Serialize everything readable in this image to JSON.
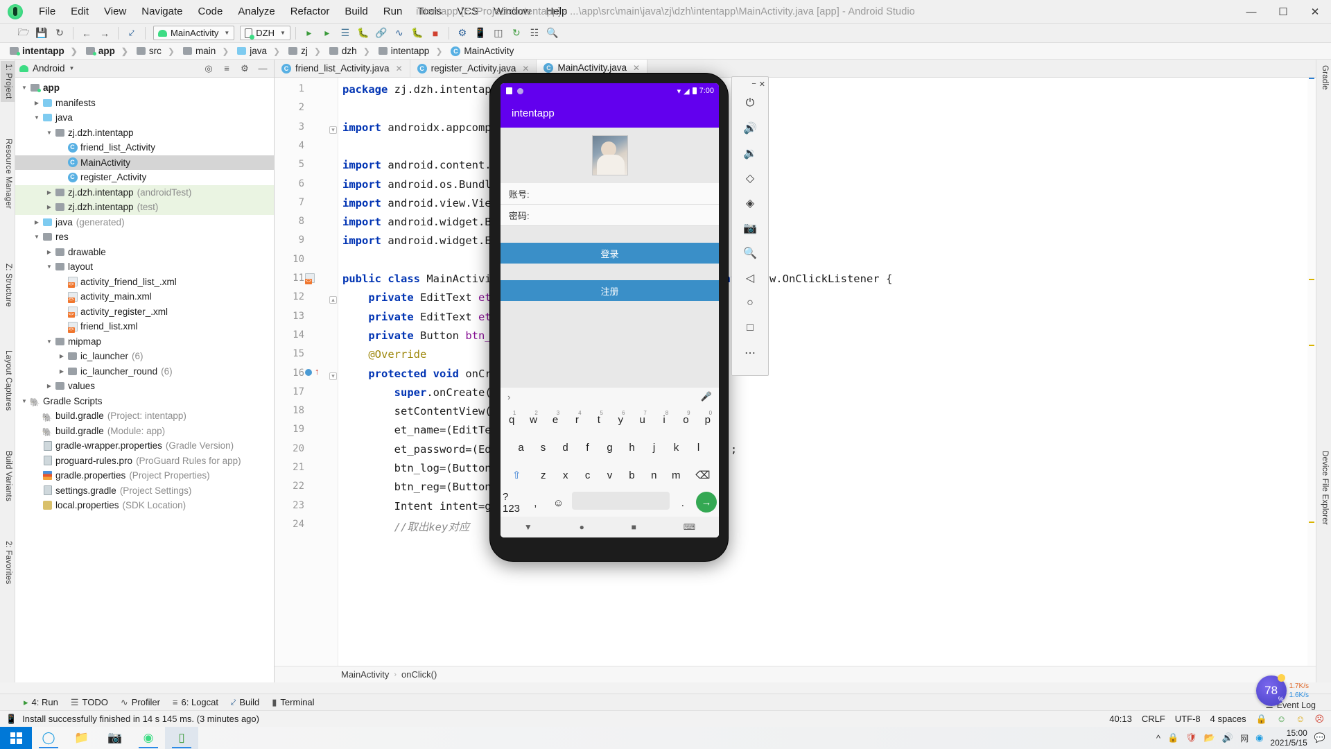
{
  "window": {
    "title": "intentapp [E:\\Projects\\intentapp] - ...\\app\\src\\main\\java\\zj\\dzh\\intentapp\\MainActivity.java [app] - Android Studio",
    "minimize": "—",
    "maximize": "☐",
    "close": "✕"
  },
  "menubar": [
    "File",
    "Edit",
    "View",
    "Navigate",
    "Code",
    "Analyze",
    "Refactor",
    "Build",
    "Run",
    "Tools",
    "VCS",
    "Window",
    "Help"
  ],
  "toolbar": {
    "run_config": "MainActivity",
    "device": "DZH",
    "icons": [
      "open-folder-icon",
      "save-icon",
      "sync-icon",
      "back-arrow-icon",
      "forward-arrow-icon",
      "undo-icon"
    ],
    "right_icons": [
      "run-icon",
      "run-coverage-icon",
      "apply-changes-icon",
      "debug-icon",
      "attach-debugger-icon",
      "profiler-icon",
      "debug-app-icon",
      "stop-icon",
      "sdk-manager-icon",
      "avd-manager-icon",
      "search-icon"
    ]
  },
  "breadcrumb": [
    {
      "label": "intentapp",
      "icon": "project-folder-icon",
      "bold": true
    },
    {
      "label": "app",
      "icon": "module-folder-icon",
      "bold": true
    },
    {
      "label": "src",
      "icon": "folder-icon",
      "bold": false
    },
    {
      "label": "main",
      "icon": "folder-icon",
      "bold": false
    },
    {
      "label": "java",
      "icon": "source-folder-icon",
      "bold": false
    },
    {
      "label": "zj",
      "icon": "package-folder-icon",
      "bold": false
    },
    {
      "label": "dzh",
      "icon": "package-folder-icon",
      "bold": false
    },
    {
      "label": "intentapp",
      "icon": "package-folder-icon",
      "bold": false
    },
    {
      "label": "MainActivity",
      "icon": "java-class-icon",
      "bold": false
    }
  ],
  "left_tool_tabs": [
    "1: Project",
    "Resource Manager",
    "Z: Structure",
    "Layout Captures",
    "Build Variants",
    "2: Favorites"
  ],
  "right_tool_tabs": [
    "Gradle",
    "Device File Explorer"
  ],
  "project_panel": {
    "view_selector": "Android",
    "header_icons": [
      "target-icon",
      "collapse-all-icon",
      "settings-gear-icon",
      "hide-icon"
    ],
    "tree": [
      {
        "depth": 0,
        "arrow": "down",
        "icon": "module-folder-icon",
        "label": "app",
        "bold": true,
        "dim": "",
        "state": "normal"
      },
      {
        "depth": 1,
        "arrow": "right",
        "icon": "folder-blue-icon",
        "label": "manifests",
        "bold": false,
        "dim": "",
        "state": "normal"
      },
      {
        "depth": 1,
        "arrow": "down",
        "icon": "folder-blue-icon",
        "label": "java",
        "bold": false,
        "dim": "",
        "state": "normal"
      },
      {
        "depth": 2,
        "arrow": "down",
        "icon": "package-icon",
        "label": "zj.dzh.intentapp",
        "bold": false,
        "dim": "",
        "state": "normal"
      },
      {
        "depth": 3,
        "arrow": "none",
        "icon": "java-class-icon",
        "label": "friend_list_Activity",
        "bold": false,
        "dim": "",
        "state": "normal"
      },
      {
        "depth": 3,
        "arrow": "none",
        "icon": "java-class-icon",
        "label": "MainActivity",
        "bold": false,
        "dim": "",
        "state": "selected"
      },
      {
        "depth": 3,
        "arrow": "none",
        "icon": "java-class-icon",
        "label": "register_Activity",
        "bold": false,
        "dim": "",
        "state": "normal"
      },
      {
        "depth": 2,
        "arrow": "right",
        "icon": "package-icon",
        "label": "zj.dzh.intentapp",
        "bold": false,
        "dim": "(androidTest)",
        "state": "green"
      },
      {
        "depth": 2,
        "arrow": "right",
        "icon": "package-icon",
        "label": "zj.dzh.intentapp",
        "bold": false,
        "dim": "(test)",
        "state": "green"
      },
      {
        "depth": 1,
        "arrow": "right",
        "icon": "generated-folder-icon",
        "label": "java",
        "bold": false,
        "dim": "(generated)",
        "state": "normal"
      },
      {
        "depth": 1,
        "arrow": "down",
        "icon": "res-folder-icon",
        "label": "res",
        "bold": false,
        "dim": "",
        "state": "normal"
      },
      {
        "depth": 2,
        "arrow": "right",
        "icon": "folder-icon",
        "label": "drawable",
        "bold": false,
        "dim": "",
        "state": "normal"
      },
      {
        "depth": 2,
        "arrow": "down",
        "icon": "folder-icon",
        "label": "layout",
        "bold": false,
        "dim": "",
        "state": "normal"
      },
      {
        "depth": 3,
        "arrow": "none",
        "icon": "xml-layout-icon",
        "label": "activity_friend_list_.xml",
        "bold": false,
        "dim": "",
        "state": "normal"
      },
      {
        "depth": 3,
        "arrow": "none",
        "icon": "xml-layout-icon",
        "label": "activity_main.xml",
        "bold": false,
        "dim": "",
        "state": "normal"
      },
      {
        "depth": 3,
        "arrow": "none",
        "icon": "xml-layout-icon",
        "label": "activity_register_.xml",
        "bold": false,
        "dim": "",
        "state": "normal"
      },
      {
        "depth": 3,
        "arrow": "none",
        "icon": "xml-layout-icon",
        "label": "friend_list.xml",
        "bold": false,
        "dim": "",
        "state": "normal"
      },
      {
        "depth": 2,
        "arrow": "down",
        "icon": "folder-icon",
        "label": "mipmap",
        "bold": false,
        "dim": "",
        "state": "normal"
      },
      {
        "depth": 3,
        "arrow": "right",
        "icon": "folder-icon",
        "label": "ic_launcher",
        "bold": false,
        "dim": "(6)",
        "state": "normal"
      },
      {
        "depth": 3,
        "arrow": "right",
        "icon": "folder-icon",
        "label": "ic_launcher_round",
        "bold": false,
        "dim": "(6)",
        "state": "normal"
      },
      {
        "depth": 2,
        "arrow": "right",
        "icon": "folder-icon",
        "label": "values",
        "bold": false,
        "dim": "",
        "state": "normal"
      },
      {
        "depth": 0,
        "arrow": "down",
        "icon": "gradle-elephant-icon",
        "label": "Gradle Scripts",
        "bold": false,
        "dim": "",
        "state": "normal"
      },
      {
        "depth": 1,
        "arrow": "none",
        "icon": "gradle-elephant-icon",
        "label": "build.gradle",
        "bold": false,
        "dim": "(Project: intentapp)",
        "state": "normal"
      },
      {
        "depth": 1,
        "arrow": "none",
        "icon": "gradle-elephant-icon",
        "label": "build.gradle",
        "bold": false,
        "dim": "(Module: app)",
        "state": "normal"
      },
      {
        "depth": 1,
        "arrow": "none",
        "icon": "properties-icon",
        "label": "gradle-wrapper.properties",
        "bold": false,
        "dim": "(Gradle Version)",
        "state": "normal"
      },
      {
        "depth": 1,
        "arrow": "none",
        "icon": "proguard-icon",
        "label": "proguard-rules.pro",
        "bold": false,
        "dim": "(ProGuard Rules for app)",
        "state": "normal"
      },
      {
        "depth": 1,
        "arrow": "none",
        "icon": "properties-bars-icon",
        "label": "gradle.properties",
        "bold": false,
        "dim": "(Project Properties)",
        "state": "normal"
      },
      {
        "depth": 1,
        "arrow": "none",
        "icon": "properties-icon",
        "label": "settings.gradle",
        "bold": false,
        "dim": "(Project Settings)",
        "state": "normal"
      },
      {
        "depth": 1,
        "arrow": "none",
        "icon": "key-icon",
        "label": "local.properties",
        "bold": false,
        "dim": "(SDK Location)",
        "state": "normal"
      }
    ]
  },
  "editor": {
    "tabs": [
      {
        "label": "friend_list_Activity.java",
        "active": false
      },
      {
        "label": "register_Activity.java",
        "active": false
      },
      {
        "label": "MainActivity.java",
        "active": true
      }
    ],
    "first_line": 1,
    "lines": [
      {
        "n": 1,
        "text": "package zj.dzh.intentapp;"
      },
      {
        "n": 2,
        "text": ""
      },
      {
        "n": 3,
        "text": "import androidx.appcompat.app.AppCompatActivity;"
      },
      {
        "n": 4,
        "text": ""
      },
      {
        "n": 5,
        "text": "import android.content.Intent;"
      },
      {
        "n": 6,
        "text": "import android.os.Bundle;"
      },
      {
        "n": 7,
        "text": "import android.view.View;"
      },
      {
        "n": 8,
        "text": "import android.widget.Button;"
      },
      {
        "n": 9,
        "text": "import android.widget.EditText;"
      },
      {
        "n": 10,
        "text": ""
      },
      {
        "n": 11,
        "text": "public class MainActivity extends AppCompatActivity implements View.OnClickListener {"
      },
      {
        "n": 12,
        "text": "    private EditText et_name;"
      },
      {
        "n": 13,
        "text": "    private EditText et_password;"
      },
      {
        "n": 14,
        "text": "    private Button btn_log,btn_reg;"
      },
      {
        "n": 15,
        "text": "    @Override"
      },
      {
        "n": 16,
        "text": "    protected void onCreate(Bundle savedInstanceState) {"
      },
      {
        "n": 17,
        "text": "        super.onCreate(savedInstanceState);"
      },
      {
        "n": 18,
        "text": "        setContentView(R.layout.activity_main);"
      },
      {
        "n": 19,
        "text": "        et_name=(EditText)findViewById(R.id.et_name);"
      },
      {
        "n": 20,
        "text": "        et_password=(EditText)findViewById(R.id.et_password);"
      },
      {
        "n": 21,
        "text": "        btn_log=(Button)findViewById(R.id.btn_log);"
      },
      {
        "n": 22,
        "text": "        btn_reg=(Button)findViewById(R.id.btn_reg);"
      },
      {
        "n": 23,
        "text": "        Intent intent=getIntent();"
      },
      {
        "n": 24,
        "text": "        //取出key对应"
      }
    ],
    "status_path": [
      "MainActivity",
      "onClick()"
    ],
    "status_sep": "›"
  },
  "emulator": {
    "window_controls": [
      "−",
      "✕"
    ],
    "toolbar_buttons": [
      {
        "name": "power-icon",
        "glyph": "⏻"
      },
      {
        "name": "volume-up-icon",
        "glyph": "🔊"
      },
      {
        "name": "volume-down-icon",
        "glyph": "🔉"
      },
      {
        "name": "rotate-left-icon",
        "glyph": "◇"
      },
      {
        "name": "rotate-right-icon",
        "glyph": "◈"
      },
      {
        "name": "screenshot-camera-icon",
        "glyph": "📷"
      },
      {
        "name": "zoom-icon",
        "glyph": "🔍"
      },
      {
        "name": "back-nav-icon",
        "glyph": "◁"
      },
      {
        "name": "home-nav-icon",
        "glyph": "○"
      },
      {
        "name": "overview-nav-icon",
        "glyph": "□"
      },
      {
        "name": "more-options-icon",
        "glyph": "⋯"
      }
    ],
    "status_bar": {
      "time": "7:00",
      "wifi": "wifi-icon",
      "signal": "signal-icon",
      "battery": "battery-icon"
    },
    "app_title": "intentapp",
    "fields": [
      {
        "label": "账号:",
        "value": ""
      },
      {
        "label": "密码:",
        "value": ""
      }
    ],
    "buttons": [
      {
        "label": "登录"
      },
      {
        "label": "注册"
      }
    ],
    "keyboard": {
      "row1": [
        {
          "k": "q",
          "num": "1"
        },
        {
          "k": "w",
          "num": "2"
        },
        {
          "k": "e",
          "num": "3"
        },
        {
          "k": "r",
          "num": "4"
        },
        {
          "k": "t",
          "num": "5"
        },
        {
          "k": "y",
          "num": "6"
        },
        {
          "k": "u",
          "num": "7"
        },
        {
          "k": "i",
          "num": "8"
        },
        {
          "k": "o",
          "num": "9"
        },
        {
          "k": "p",
          "num": "0"
        }
      ],
      "row2": [
        "a",
        "s",
        "d",
        "f",
        "g",
        "h",
        "j",
        "k",
        "l"
      ],
      "row3": [
        "⇧",
        "z",
        "x",
        "c",
        "v",
        "b",
        "n",
        "m",
        "⌫"
      ],
      "row4": [
        "?123",
        ",",
        "☺",
        " ",
        ".",
        "→"
      ],
      "mic": "microphone-icon",
      "suggest_arrow": "›"
    },
    "nav_buttons": [
      "▼",
      "●",
      "■",
      "⌨"
    ]
  },
  "bottom_tools": [
    {
      "label": "4: Run",
      "icon": "run-icon"
    },
    {
      "label": "TODO",
      "icon": "todo-icon"
    },
    {
      "label": "Profiler",
      "icon": "profiler-icon"
    },
    {
      "label": "6: Logcat",
      "icon": "logcat-icon"
    },
    {
      "label": "Build",
      "icon": "build-hammer-icon"
    },
    {
      "label": "Terminal",
      "icon": "terminal-icon"
    }
  ],
  "event_log": "Event Log",
  "statusbar": {
    "message": "Install successfully finished in 14 s 145 ms. (3 minutes ago)",
    "icon": "device-icon",
    "caret_position": "40:13",
    "line_separator": "CRLF",
    "encoding": "UTF-8",
    "indent": "4 spaces",
    "lock": "read-only-lock-icon",
    "faces": [
      "☺",
      "☺",
      "☹"
    ]
  },
  "performance_hud": {
    "cpu_percent": "78",
    "percent_sign": "%",
    "upload": "1.7K/s",
    "download": "1.6K/s"
  },
  "taskbar": {
    "start": "windows-start-icon",
    "apps": [
      {
        "name": "cortana-icon",
        "glyph": "◯",
        "running": true,
        "active": false
      },
      {
        "name": "file-explorer-icon",
        "glyph": "📁",
        "running": false,
        "active": false
      },
      {
        "name": "screenshot-tool-icon",
        "glyph": "📷",
        "running": false,
        "active": false
      },
      {
        "name": "android-studio-icon",
        "glyph": "◯",
        "running": true,
        "active": false
      },
      {
        "name": "emulator-icon",
        "glyph": "▭",
        "running": true,
        "active": true
      }
    ],
    "tray": [
      "∧",
      "🔒",
      "🛡",
      "📁",
      "🔊",
      "网",
      "S"
    ],
    "time": "15:00",
    "date": "2021/5/15",
    "notification": "notification-icon"
  },
  "colors": {
    "accent": "#4387c7",
    "android_purple": "#6200ee",
    "button_blue": "#3a8fc8",
    "green": "#3ddc84"
  }
}
